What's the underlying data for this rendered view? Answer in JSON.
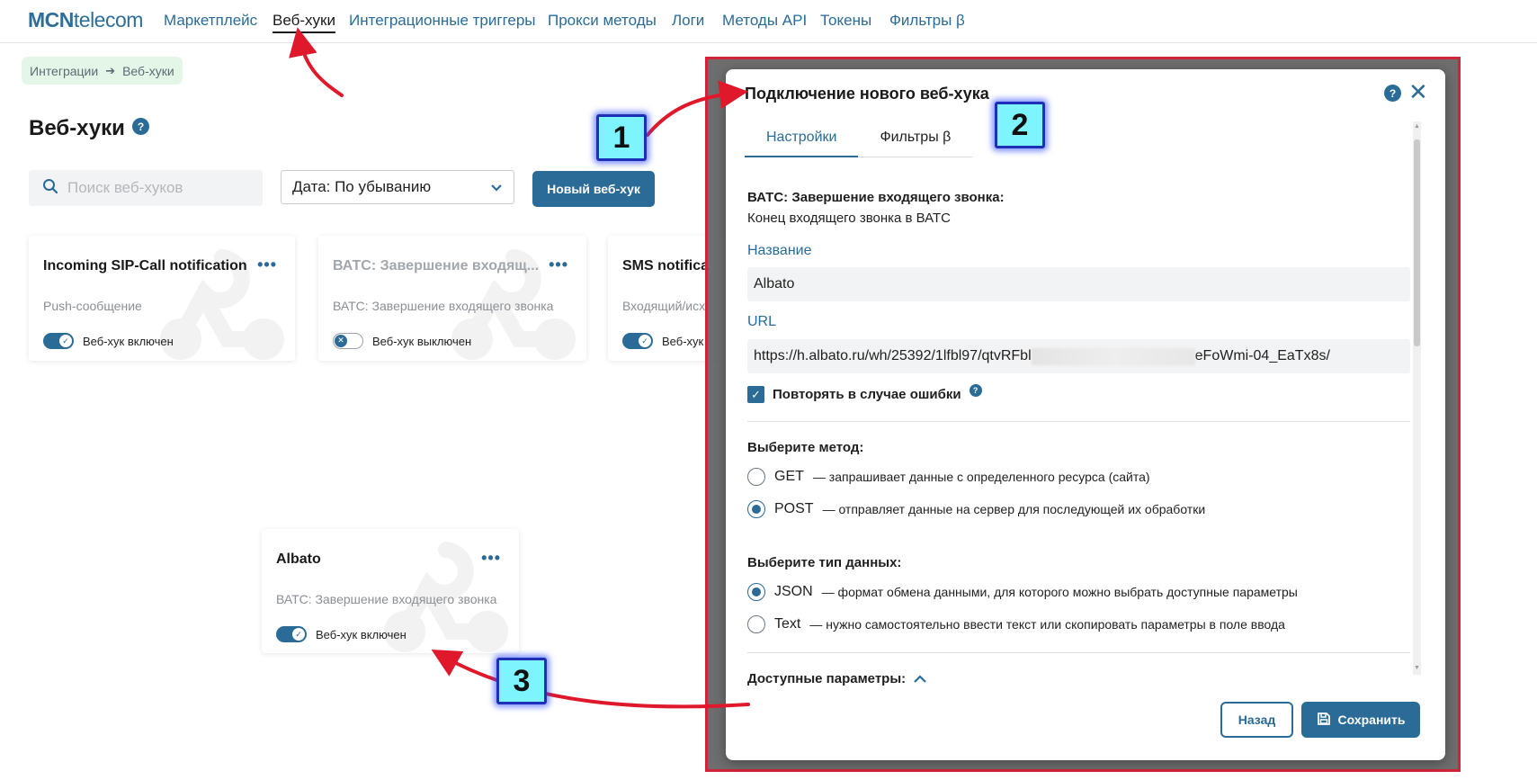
{
  "nav": {
    "logo_bold": "MCN",
    "logo_rest": "telecom",
    "items": [
      {
        "label": "Маркетплейс"
      },
      {
        "label": "Веб-хуки"
      },
      {
        "label": "Интеграционные триггеры"
      },
      {
        "label": "Прокси методы"
      },
      {
        "label": "Логи"
      },
      {
        "label": "Методы API"
      },
      {
        "label": "Токены"
      },
      {
        "label": "Фильтры β"
      }
    ]
  },
  "breadcrumb": {
    "root": "Интеграции",
    "current": "Веб-хуки"
  },
  "page": {
    "title": "Веб-хуки",
    "help": "?"
  },
  "controls": {
    "search_placeholder": "Поиск веб-хуков",
    "sort_value": "Дата: По убыванию",
    "new_button": "Новый веб-хук"
  },
  "cards": [
    {
      "title": "Incoming SIP-Call notification",
      "subtitle": "Push-сообщение",
      "status": "Веб-хук включен",
      "enabled": true
    },
    {
      "title": "ВАТС: Завершение входящ...",
      "subtitle": "ВАТС: Завершение входящего звонка",
      "status": "Веб-хук выключен",
      "enabled": false
    },
    {
      "title": "SMS notifica",
      "subtitle": "Входящий/исх",
      "status": "Веб-хук",
      "enabled": true
    },
    {
      "title": "Albato",
      "subtitle": "ВАТС: Завершение входящего звонка",
      "status": "Веб-хук включен",
      "enabled": true
    }
  ],
  "card_menu": "•••",
  "modal": {
    "title": "Подключение нового веб-хука",
    "tabs": [
      {
        "label": "Настройки"
      },
      {
        "label": "Фильтры β"
      }
    ],
    "event_heading": "ВАТС: Завершение входящего звонка:",
    "event_desc": "Конец входящего звонка в ВАТС",
    "name_label": "Название",
    "name_value": "Albato",
    "url_label": "URL",
    "url_start": "https://h.albato.ru/wh/25392/1lfbl97/qtvRFbl",
    "url_end": "eFoWmi-04_EaTx8s/",
    "retry_label": "Повторять в случае ошибки",
    "method_heading": "Выберите метод:",
    "methods": [
      {
        "name": "GET",
        "desc": "— запрашивает данные с определенного ресурса (сайта)",
        "checked": false
      },
      {
        "name": "POST",
        "desc": "— отправляет данные на сервер для последующей их обработки",
        "checked": true
      }
    ],
    "datatype_heading": "Выберите тип данных:",
    "datatypes": [
      {
        "name": "JSON",
        "desc": "— формат обмена данными, для которого можно выбрать доступные параметры",
        "checked": true
      },
      {
        "name": "Text",
        "desc": "— нужно самостоятельно ввести текст или скопировать параметры в поле ввода",
        "checked": false
      }
    ],
    "params_heading": "Доступные параметры:",
    "back_button": "Назад",
    "save_button": "Сохранить"
  },
  "annotations": [
    "1",
    "2",
    "3"
  ],
  "colors": {
    "accent": "#2a6b97",
    "highlight_border": "#d2233a",
    "arrow": "#e0182b",
    "callout_fill": "#7ef4ff",
    "callout_border": "#1e2fb8"
  }
}
